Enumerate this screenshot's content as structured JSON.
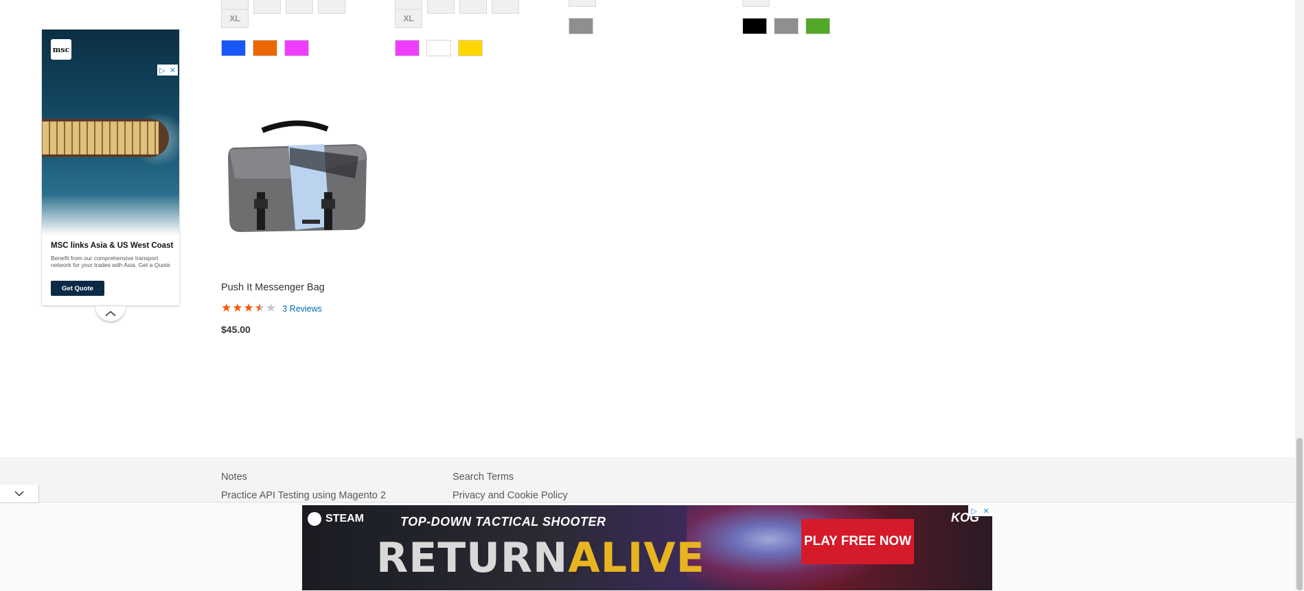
{
  "products_top": {
    "col1": {
      "size_label": "XL",
      "colors": [
        "#1857f7",
        "#eb6703",
        "#ef3dff"
      ]
    },
    "col2": {
      "size_label": "XL",
      "colors": [
        "#ef3dff",
        "#ffffff",
        "#ffd500"
      ]
    },
    "col3": {
      "colors": [
        "#8f8f8f"
      ]
    },
    "col4": {
      "colors": [
        "#000000",
        "#8f8f8f",
        "#53a828"
      ]
    }
  },
  "side_ad": {
    "logo_text": "msc",
    "headline": "MSC links Asia & US West Coast",
    "body": "Benefit from our comprehensive transport network for your trades with Asia. Get a Quote",
    "cta": "Get Quote"
  },
  "product": {
    "name": "Push It Messenger Bag",
    "rating_stars": 3.5,
    "rating_max": 5,
    "reviews_label": "3 Reviews",
    "price": "$45.00",
    "star_color": "#ff5501"
  },
  "footer": {
    "links_col1": [
      "Notes",
      "Practice API Testing using Magento 2"
    ],
    "links_col2": [
      "Search Terms",
      "Privacy and Cookie Policy"
    ]
  },
  "bottom_ad": {
    "platform": "STEAM",
    "tagline": "TOP-DOWN TACTICAL SHOOTER",
    "title_part1": "RETURN",
    "title_part2": "ALIVE",
    "cta": "PLAY FREE NOW",
    "brand": "KOG"
  }
}
